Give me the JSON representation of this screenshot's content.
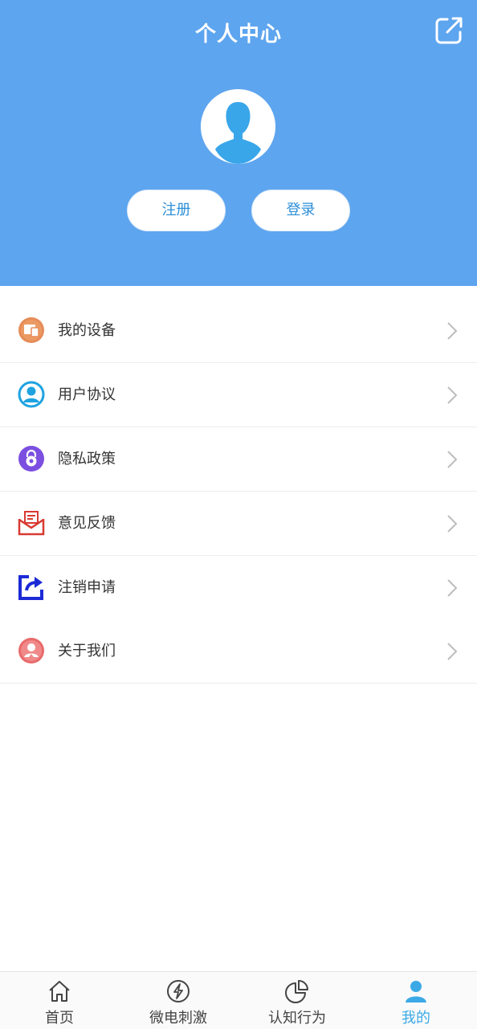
{
  "header": {
    "title": "个人中心",
    "register_label": "注册",
    "login_label": "登录"
  },
  "menu": {
    "items": [
      {
        "label": "我的设备",
        "icon": "device-icon"
      },
      {
        "label": "用户协议",
        "icon": "user-agreement-icon"
      },
      {
        "label": "隐私政策",
        "icon": "privacy-lock-icon"
      },
      {
        "label": "意见反馈",
        "icon": "feedback-envelope-icon"
      },
      {
        "label": "注销申请",
        "icon": "cancel-request-icon"
      },
      {
        "label": "关于我们",
        "icon": "about-us-icon"
      }
    ]
  },
  "tabbar": {
    "items": [
      {
        "label": "首页",
        "icon": "home-icon"
      },
      {
        "label": "微电刺激",
        "icon": "lightning-icon"
      },
      {
        "label": "认知行为",
        "icon": "pie-chart-icon"
      },
      {
        "label": "我的",
        "icon": "person-icon",
        "active": true
      }
    ]
  },
  "colors": {
    "header_bg": "#5ea5ef",
    "accent": "#3ba9e6",
    "button_text": "#2d8fd8"
  }
}
